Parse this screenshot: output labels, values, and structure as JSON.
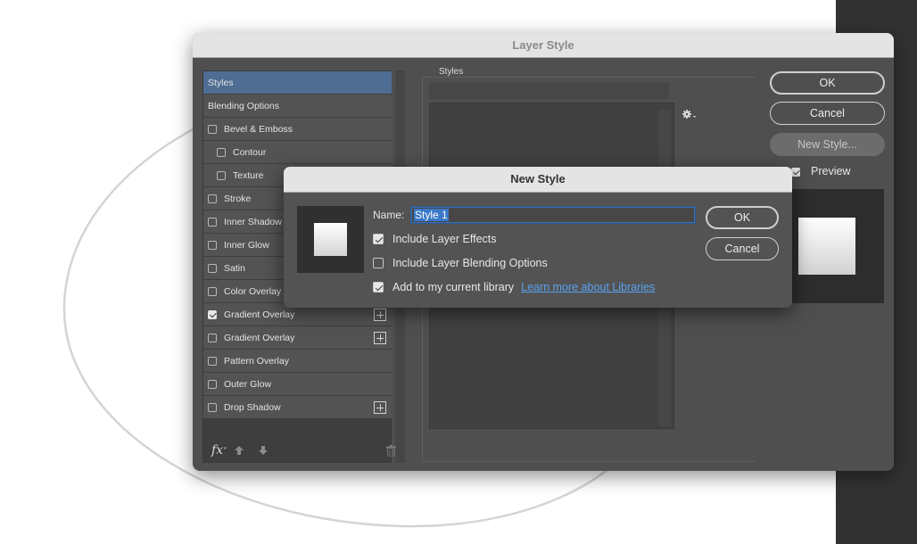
{
  "layer_style": {
    "title": "Layer Style",
    "list": [
      {
        "label": "Styles",
        "checkbox": false,
        "selected": true,
        "indent": 0,
        "plus": false
      },
      {
        "label": "Blending Options",
        "checkbox": false,
        "selected": false,
        "indent": 0,
        "plus": false
      },
      {
        "label": "Bevel & Emboss",
        "checkbox": true,
        "checked": false,
        "indent": 0,
        "plus": false
      },
      {
        "label": "Contour",
        "checkbox": true,
        "checked": false,
        "indent": 1,
        "plus": false
      },
      {
        "label": "Texture",
        "checkbox": true,
        "checked": false,
        "indent": 1,
        "plus": false
      },
      {
        "label": "Stroke",
        "checkbox": true,
        "checked": false,
        "indent": 0,
        "plus": true
      },
      {
        "label": "Inner Shadow",
        "checkbox": true,
        "checked": false,
        "indent": 0,
        "plus": true
      },
      {
        "label": "Inner Glow",
        "checkbox": true,
        "checked": false,
        "indent": 0,
        "plus": false
      },
      {
        "label": "Satin",
        "checkbox": true,
        "checked": false,
        "indent": 0,
        "plus": false
      },
      {
        "label": "Color Overlay",
        "checkbox": true,
        "checked": false,
        "indent": 0,
        "plus": true
      },
      {
        "label": "Gradient Overlay",
        "checkbox": true,
        "checked": true,
        "indent": 0,
        "plus": true
      },
      {
        "label": "Gradient Overlay",
        "checkbox": true,
        "checked": false,
        "indent": 0,
        "plus": true
      },
      {
        "label": "Pattern Overlay",
        "checkbox": true,
        "checked": false,
        "indent": 0,
        "plus": false
      },
      {
        "label": "Outer Glow",
        "checkbox": true,
        "checked": false,
        "indent": 0,
        "plus": false
      },
      {
        "label": "Drop Shadow",
        "checkbox": true,
        "checked": false,
        "indent": 0,
        "plus": true
      }
    ],
    "footer_icons": [
      "fx-icon",
      "move-up-icon",
      "move-down-icon",
      "trash-icon"
    ],
    "styles_group_label": "Styles",
    "buttons": {
      "ok": "OK",
      "cancel": "Cancel",
      "new_style": "New Style..."
    },
    "preview": {
      "label": "Preview",
      "checked": true
    }
  },
  "new_style": {
    "title": "New Style",
    "name_label": "Name:",
    "name_value": "Style 1",
    "options": [
      {
        "label": "Include Layer Effects",
        "checked": true
      },
      {
        "label": "Include Layer Blending Options",
        "checked": false
      },
      {
        "label": "Add to my current library",
        "checked": true,
        "link": "Learn more about Libraries"
      }
    ],
    "ok_label": "OK",
    "cancel_label": "Cancel"
  },
  "colors": {
    "dialog_bg": "#4f4f4f",
    "titlebar": "#e4e4e4",
    "selected_item": "#4f6c92",
    "link": "#58a2f0"
  }
}
